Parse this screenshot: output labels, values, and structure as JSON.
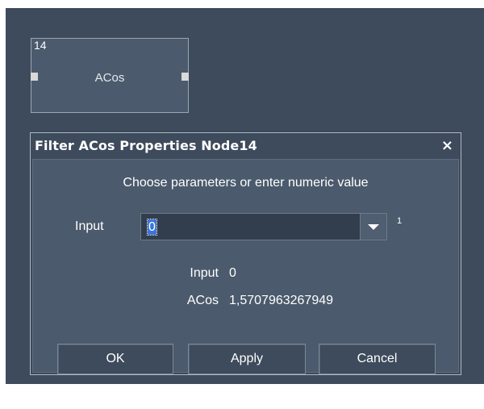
{
  "node": {
    "id": "14",
    "label": "ACos"
  },
  "dialog": {
    "title": "Filter ACos Properties Node14",
    "close_glyph": "×",
    "instructions": "Choose parameters or enter numeric value",
    "input_label": "Input",
    "input_value": "0",
    "input_index": "1",
    "info": [
      {
        "label": "Input",
        "value": "0"
      },
      {
        "label": "ACos",
        "value": "1,5707963267949"
      }
    ],
    "buttons": {
      "ok": "OK",
      "apply": "Apply",
      "cancel": "Cancel"
    }
  },
  "icons": {
    "close": "close-icon",
    "dropdown": "chevron-down-icon"
  },
  "colors": {
    "canvas": "#3d4b5c",
    "panel": "#4b5a6c",
    "selection": "#3b76d8"
  }
}
